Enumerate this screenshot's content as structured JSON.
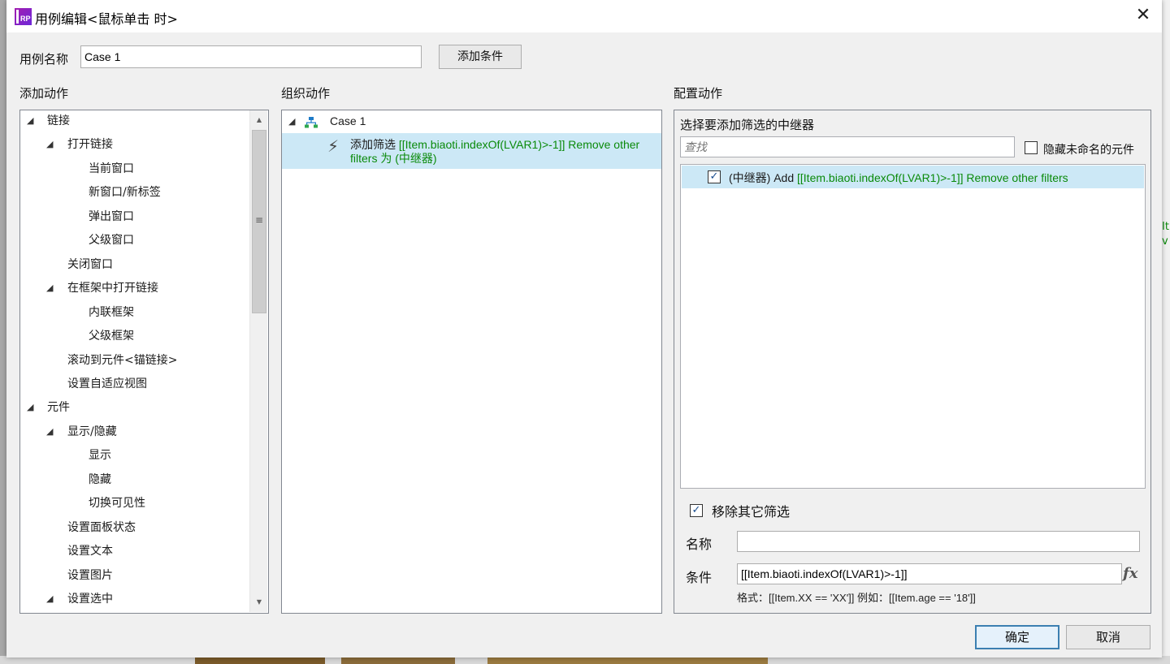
{
  "dialog": {
    "title": "用例编辑<鼠标单击 时>",
    "close_symbol": "✕"
  },
  "case_name": {
    "label": "用例名称",
    "value": "Case 1",
    "add_condition_button": "添加条件"
  },
  "add_actions": {
    "heading": "添加动作",
    "tree": [
      {
        "label": "链接",
        "level": 0,
        "expanded": true
      },
      {
        "label": "打开链接",
        "level": 1,
        "expanded": true
      },
      {
        "label": "当前窗口",
        "level": 2
      },
      {
        "label": "新窗口/新标签",
        "level": 2
      },
      {
        "label": "弹出窗口",
        "level": 2
      },
      {
        "label": "父级窗口",
        "level": 2
      },
      {
        "label": "关闭窗口",
        "level": 1
      },
      {
        "label": "在框架中打开链接",
        "level": 1,
        "expanded": true
      },
      {
        "label": "内联框架",
        "level": 2
      },
      {
        "label": "父级框架",
        "level": 2
      },
      {
        "label": "滚动到元件<锚链接>",
        "level": 1
      },
      {
        "label": "设置自适应视图",
        "level": 1
      },
      {
        "label": "元件",
        "level": 0,
        "expanded": true
      },
      {
        "label": "显示/隐藏",
        "level": 1,
        "expanded": true
      },
      {
        "label": "显示",
        "level": 2
      },
      {
        "label": "隐藏",
        "level": 2
      },
      {
        "label": "切换可见性",
        "level": 2
      },
      {
        "label": "设置面板状态",
        "level": 1
      },
      {
        "label": "设置文本",
        "level": 1
      },
      {
        "label": "设置图片",
        "level": 1
      },
      {
        "label": "设置选中",
        "level": 1,
        "expanded": true
      }
    ]
  },
  "organize_actions": {
    "heading": "组织动作",
    "case_label": "Case 1",
    "action_prefix": "添加筛选 ",
    "action_expr": "[[Item.biaoti.indexOf(LVAR1)>-1]] Remove other filters 为 (中继器)"
  },
  "configure_actions": {
    "heading": "配置动作",
    "select_label": "选择要添加筛选的中继器",
    "search_placeholder": "查找",
    "hide_unnamed_label": "隐藏未命名的元件",
    "hide_unnamed_checked": false,
    "repeater_item": {
      "checked": true,
      "prefix": "(中继器) Add ",
      "expr": "[[Item.biaoti.indexOf(LVAR1)>-1]] Remove other filters"
    },
    "remove_other_filters_label": "移除其它筛选",
    "remove_other_filters_checked": true,
    "name_label": "名称",
    "name_value": "",
    "condition_label": "条件",
    "condition_value": "[[Item.biaoti.indexOf(LVAR1)>-1]]",
    "fx_label": "fx",
    "format_hint": "格式：[[Item.XX == 'XX']] 例如：[[Item.age == '18']]"
  },
  "footer": {
    "ok_button": "确定",
    "cancel_button": "取消"
  },
  "colors": {
    "selection": "#cce8f6",
    "expression_green": "#0a8a0a",
    "dialog_bg": "#f0f0f0"
  }
}
